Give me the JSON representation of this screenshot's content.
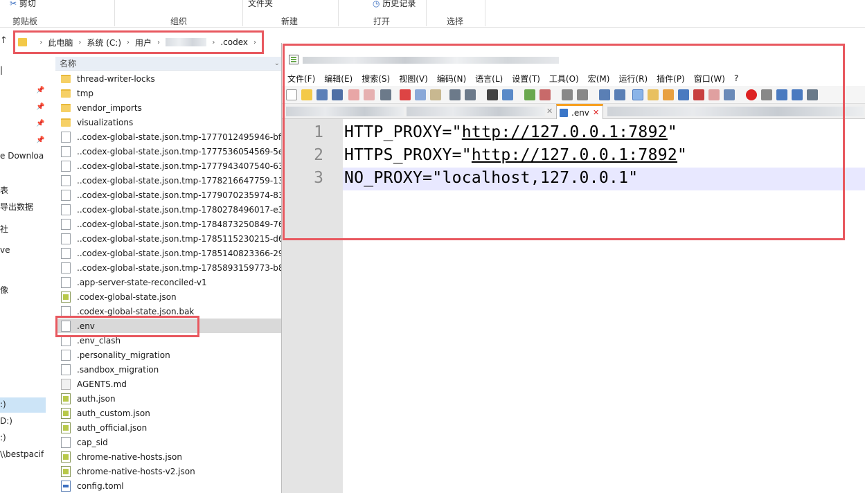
{
  "ribbon": {
    "top_labels": [
      "剪切",
      "文件夹",
      "历史记录"
    ],
    "groups": [
      "剪贴板",
      "组织",
      "新建",
      "打开",
      "选择"
    ]
  },
  "breadcrumb": {
    "items": [
      "此电脑",
      "系统 (C:)",
      "用户",
      ".codex"
    ]
  },
  "nav": {
    "items": [
      "e Downloa",
      "表",
      "导出数据",
      "社",
      "ve",
      "像",
      ":)",
      "D:)",
      ":)",
      "\\\\bestpacif"
    ]
  },
  "list": {
    "column_name": "名称",
    "rows": [
      {
        "name": "thread-writer-locks",
        "icon": "folder"
      },
      {
        "name": "tmp",
        "icon": "folder"
      },
      {
        "name": "vendor_imports",
        "icon": "folder"
      },
      {
        "name": "visualizations",
        "icon": "folder"
      },
      {
        "name": "..codex-global-state.json.tmp-1777012495946-bf...",
        "icon": "file"
      },
      {
        "name": "..codex-global-state.json.tmp-1777536054569-5e...",
        "icon": "file"
      },
      {
        "name": "..codex-global-state.json.tmp-1777943407540-63...",
        "icon": "file"
      },
      {
        "name": "..codex-global-state.json.tmp-1778216647759-13...",
        "icon": "file"
      },
      {
        "name": "..codex-global-state.json.tmp-1779070235974-83...",
        "icon": "file"
      },
      {
        "name": "..codex-global-state.json.tmp-1780278496017-e3...",
        "icon": "file"
      },
      {
        "name": "..codex-global-state.json.tmp-1784873250849-76...",
        "icon": "file"
      },
      {
        "name": "..codex-global-state.json.tmp-1785115230215-d6...",
        "icon": "file"
      },
      {
        "name": "..codex-global-state.json.tmp-1785140823366-29...",
        "icon": "file"
      },
      {
        "name": "..codex-global-state.json.tmp-1785893159773-b8...",
        "icon": "file"
      },
      {
        "name": ".app-server-state-reconciled-v1",
        "icon": "file"
      },
      {
        "name": ".codex-global-state.json",
        "icon": "json"
      },
      {
        "name": ".codex-global-state.json.bak",
        "icon": "file"
      },
      {
        "name": ".env",
        "icon": "file"
      },
      {
        "name": ".env_clash",
        "icon": "file"
      },
      {
        "name": ".personality_migration",
        "icon": "file"
      },
      {
        "name": ".sandbox_migration",
        "icon": "file"
      },
      {
        "name": "AGENTS.md",
        "icon": "md"
      },
      {
        "name": "auth.json",
        "icon": "json"
      },
      {
        "name": "auth_custom.json",
        "icon": "json"
      },
      {
        "name": "auth_official.json",
        "icon": "json"
      },
      {
        "name": "cap_sid",
        "icon": "file"
      },
      {
        "name": "chrome-native-hosts.json",
        "icon": "json"
      },
      {
        "name": "chrome-native-hosts-v2.json",
        "icon": "json"
      },
      {
        "name": "config.toml",
        "icon": "toml"
      }
    ]
  },
  "npp": {
    "menu": [
      "文件(F)",
      "编辑(E)",
      "搜索(S)",
      "视图(V)",
      "编码(N)",
      "语言(L)",
      "设置(T)",
      "工具(O)",
      "宏(M)",
      "运行(R)",
      "插件(P)",
      "窗口(W)",
      "?"
    ],
    "active_tab": ".env",
    "lines": [
      {
        "num": "1",
        "pre": "HTTP_PROXY=\"",
        "url": "http://127.0.0.1:7892",
        "post": "\""
      },
      {
        "num": "2",
        "pre": "HTTPS_PROXY=\"",
        "url": "http://127.0.0.1:7892",
        "post": "\""
      },
      {
        "num": "3",
        "pre": "NO_PROXY=\"localhost,127.0.0.1\"",
        "url": "",
        "post": ""
      }
    ]
  },
  "colors": {
    "highlight_border": "#e8585f",
    "current_line": "#e8e8ff",
    "folder": "#f6d065"
  }
}
